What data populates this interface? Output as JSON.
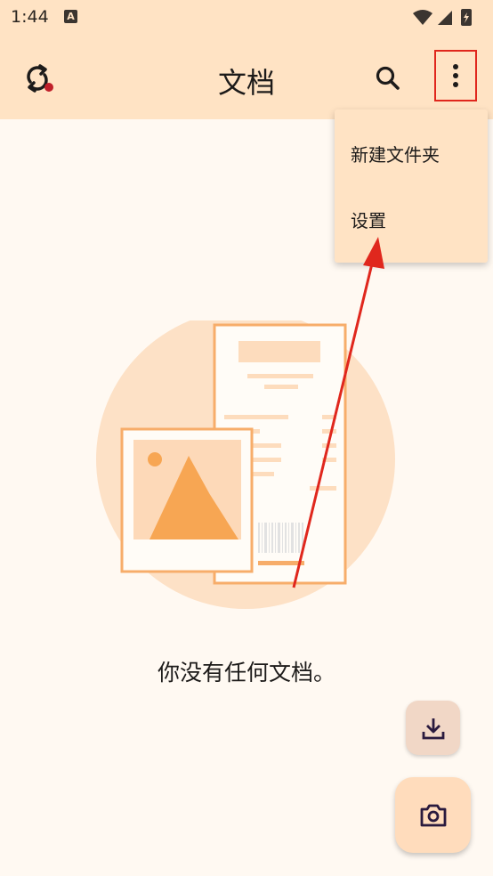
{
  "status_bar": {
    "time": "1:44",
    "notification_icon": "A"
  },
  "app_bar": {
    "title": "文档",
    "sync_icon": "sync-icon",
    "search_icon": "search-icon",
    "more_icon": "more-vert-icon"
  },
  "overflow_menu": {
    "items": [
      {
        "label": "新建文件夹"
      },
      {
        "label": "设置"
      }
    ]
  },
  "empty_state": {
    "message": "你没有任何文档。"
  },
  "fab": {
    "import_icon": "download-icon",
    "camera_icon": "camera-icon"
  },
  "colors": {
    "app_bar": "#ffe3c4",
    "background": "#fff9f2",
    "annotation": "#e0271d"
  }
}
